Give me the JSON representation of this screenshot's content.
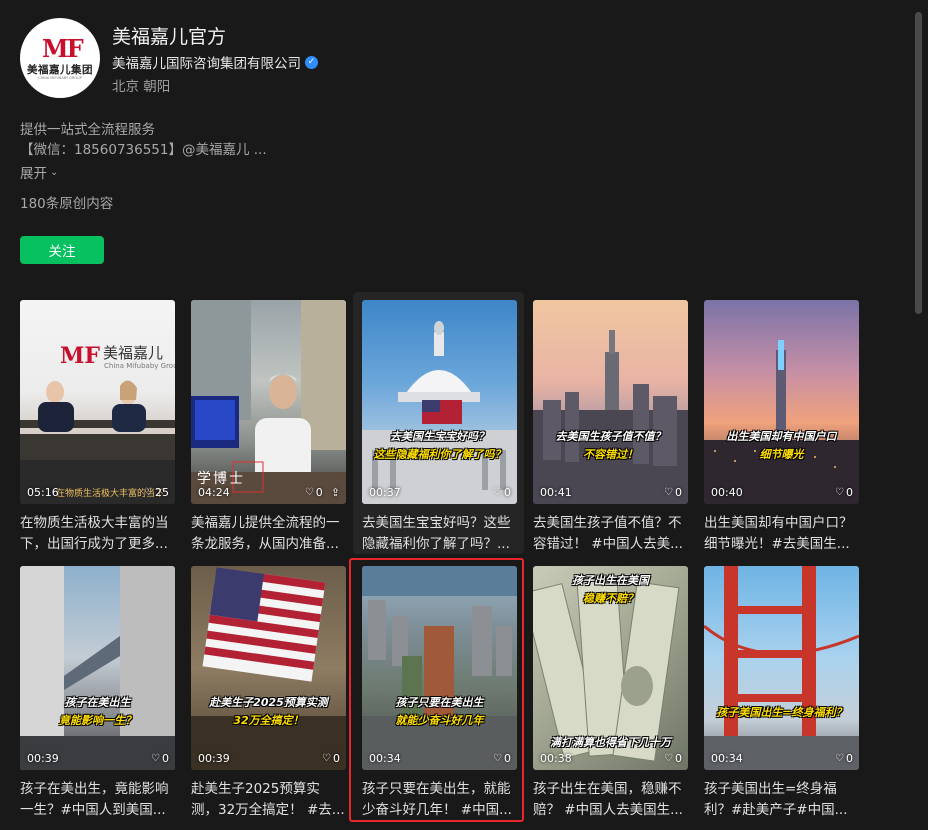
{
  "profile": {
    "avatar_mark": "MF",
    "avatar_brand": "美福嘉儿集团",
    "avatar_brand_en": "CHINA MIFUBABY GROUP",
    "name": "美福嘉儿官方",
    "company": "美福嘉儿国际咨询集团有限公司",
    "location": "北京 朝阳",
    "description_line1": "提供一站式全流程服务",
    "description_line2": "【微信：18560736551】@美福嘉儿 ...",
    "expand_label": "展开",
    "original_count": "180条原创内容",
    "follow_label": "关注"
  },
  "videos": [
    {
      "duration": "05:16",
      "likes": "25",
      "title": "在物质生活极大丰富的当下，出国行成为了更多...",
      "thumb_text": "美福嘉儿",
      "thumb_sub": "China Mifubaby Grou",
      "caption": "在物质生活极大丰富的当下"
    },
    {
      "duration": "04:24",
      "likes": "0",
      "title": "美福嘉儿提供全流程的一条龙服务，从国内准备...",
      "thumb_text": "学博士"
    },
    {
      "duration": "00:37",
      "likes": "0",
      "title": "去美国生宝宝好吗？这些隐藏福利你了解了吗？...",
      "cap_line1": "去美国生宝宝好吗？",
      "cap_line2": "这些隐藏福利你了解了吗？"
    },
    {
      "duration": "00:41",
      "likes": "0",
      "title": "去美国生孩子值不值？不容错过！ #中国人去美...",
      "cap_line1": "去美国生孩子值不值？",
      "cap_line2": "不容错过！"
    },
    {
      "duration": "00:40",
      "likes": "0",
      "title": "出生美国却有中国户口？细节曝光！#去美国生...",
      "cap_line1": "出生美国却有中国户口",
      "cap_line2": "细节曝光"
    },
    {
      "duration": "00:39",
      "likes": "0",
      "title": "孩子在美出生，竟能影响一生？#中国人到美国...",
      "cap_line1": "孩子在美出生",
      "cap_line2": "竟能影响一生？"
    },
    {
      "duration": "00:39",
      "likes": "0",
      "title": "赴美生子2025预算实测，32万全搞定！ #去...",
      "cap_line1": "赴美生子2025预算实测",
      "cap_line2": "32万全搞定！"
    },
    {
      "duration": "00:34",
      "likes": "0",
      "title": "孩子只要在美出生，就能少奋斗好几年！ #中国...",
      "cap_line1": "孩子只要在美出生",
      "cap_line2": "就能少奋斗好几年"
    },
    {
      "duration": "00:38",
      "likes": "0",
      "title": "孩子出生在美国，稳赚不赔？ #中国人去美国生...",
      "cap_line1": "孩子出生在美国",
      "cap_line2": "稳赚不赔？",
      "cap_bottom": "满打满算也得省下几十万"
    },
    {
      "duration": "00:34",
      "likes": "0",
      "title": "孩子美国出生=终身福利？#赴美产子#中国...",
      "cap_line1": "孩子美国出生=终身福利？"
    }
  ],
  "colors": {
    "background": "#191919",
    "accent": "#07c160",
    "verified": "#2f8cff",
    "selection": "#e8262b"
  }
}
